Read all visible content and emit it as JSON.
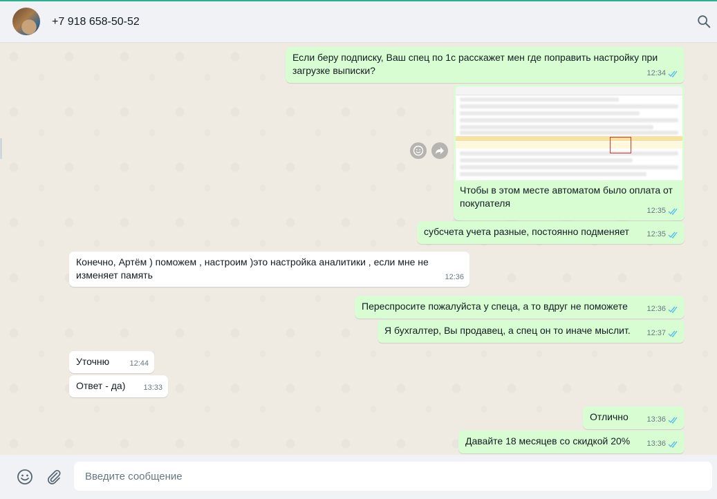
{
  "header": {
    "contact_name": "+7 918 658-50-52",
    "search_icon": "search-icon"
  },
  "messages": [
    {
      "direction": "out",
      "text": "Если беру подписку, Ваш спец по 1с расскажет мен где поправить настройку при загрузке выписки?",
      "time": "12:34",
      "status": "read"
    },
    {
      "direction": "out",
      "type": "image",
      "text": "Чтобы в этом месте автоматом было оплата от покупателя",
      "time": "12:35",
      "status": "read"
    },
    {
      "direction": "out",
      "text": "субсчета учета разные, постоянно подменяет",
      "time": "12:35",
      "status": "read"
    },
    {
      "direction": "in",
      "text": "Конечно, Артём ) поможем , настроим )это настройка аналитики , если мне не изменяет память",
      "time": "12:36"
    },
    {
      "direction": "out",
      "text": "Переспросите пожалуйста у спеца, а то вдруг не поможете",
      "time": "12:36",
      "status": "read"
    },
    {
      "direction": "out",
      "text": "Я бухгалтер, Вы продавец, а спец он то иначе мыслит.",
      "time": "12:37",
      "status": "read"
    },
    {
      "direction": "in",
      "text": "Уточню",
      "time": "12:44"
    },
    {
      "direction": "in",
      "text": "Ответ - да)",
      "time": "13:33"
    },
    {
      "direction": "out",
      "text": "Отлично",
      "time": "13:36",
      "status": "read"
    },
    {
      "direction": "out",
      "text": "Давайте 18 месяцев со скидкой 20%",
      "time": "13:36",
      "status": "read"
    }
  ],
  "composer": {
    "placeholder": "Введите сообщение",
    "value": ""
  },
  "colors": {
    "outgoing_bubble": "#d9fdd3",
    "incoming_bubble": "#ffffff",
    "read_ticks": "#53bdeb",
    "accent": "#25b38f"
  }
}
